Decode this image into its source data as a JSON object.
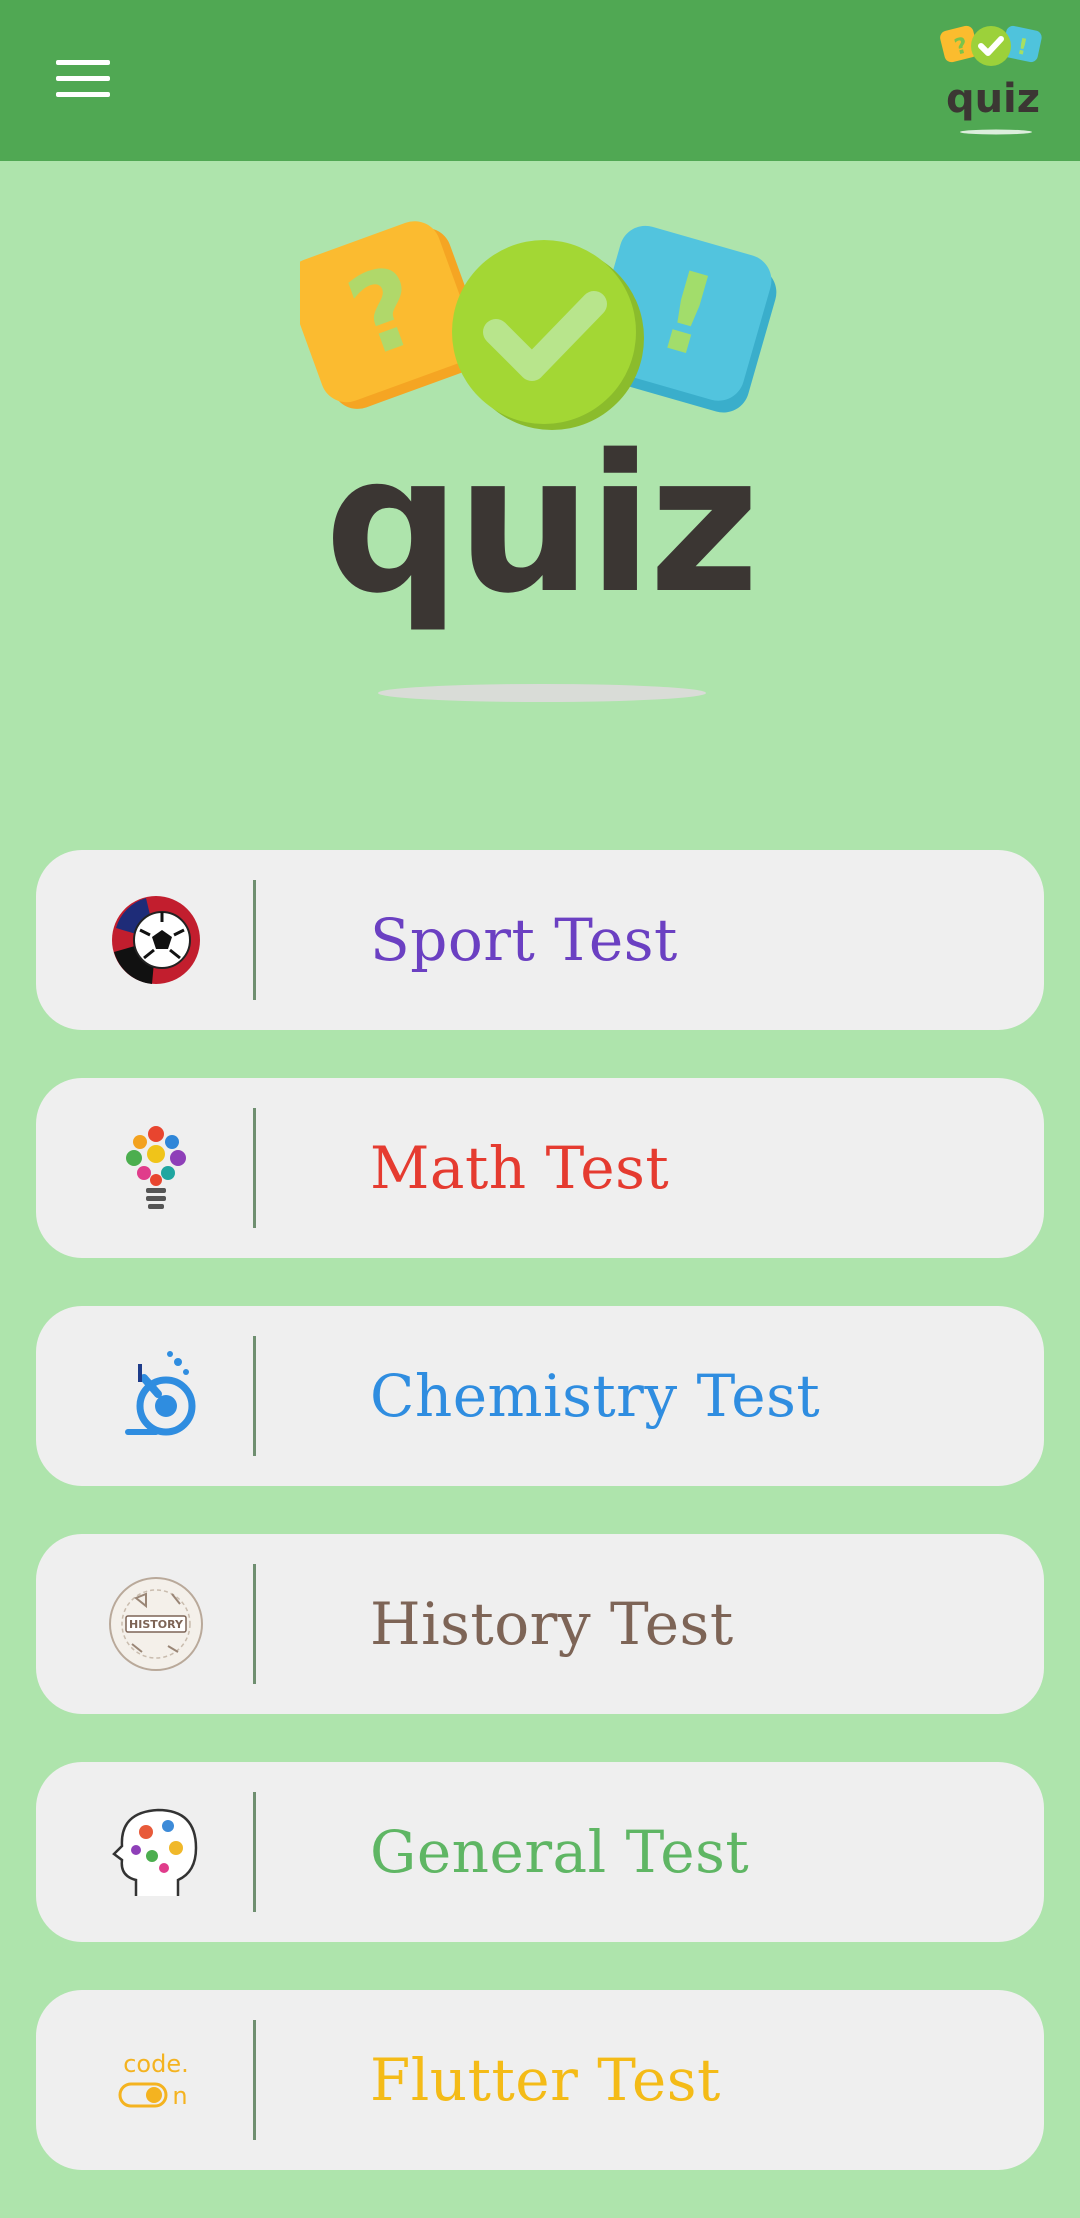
{
  "appbar": {
    "menu_icon": "hamburger-menu-icon",
    "logo_text": "quiz"
  },
  "hero": {
    "logo_text": "quiz",
    "logo_icon": "quiz-logo"
  },
  "colors": {
    "appbar": "#50a853",
    "background": "#aee4ac",
    "card": "#efefef"
  },
  "tests": [
    {
      "label": "Sport Test",
      "color": "#6b40c2",
      "icon": "soccer-ball-icon"
    },
    {
      "label": "Math Test",
      "color": "#e53b30",
      "icon": "gear-lightbulb-icon"
    },
    {
      "label": "Chemistry Test",
      "color": "#2f8de0",
      "icon": "microscope-icon"
    },
    {
      "label": "History Test",
      "color": "#7d6456",
      "icon": "history-circle-icon"
    },
    {
      "label": "General Test",
      "color": "#5fb664",
      "icon": "head-brain-icon"
    },
    {
      "label": "Flutter Test",
      "color": "#f4bb17",
      "icon": "code-on-icon",
      "icon_text": "code.",
      "icon_text2": "n"
    }
  ]
}
